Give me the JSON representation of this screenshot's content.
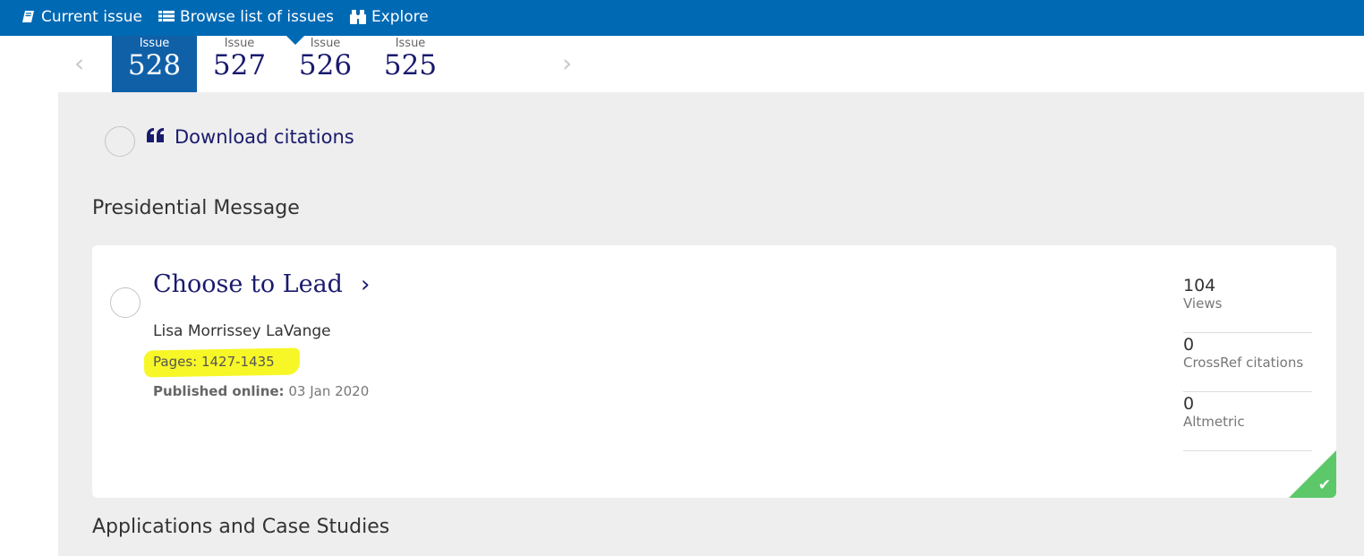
{
  "topnav": {
    "items": [
      {
        "icon": "book-icon",
        "label": "Current issue"
      },
      {
        "icon": "list-icon",
        "label": "Browse list of issues"
      },
      {
        "icon": "binoculars-icon",
        "label": "Explore"
      }
    ]
  },
  "issues": {
    "prev_icon": "‹",
    "next_icon": "›",
    "items": [
      {
        "label": "Issue",
        "number": "528",
        "active": true
      },
      {
        "label": "Issue",
        "number": "527"
      },
      {
        "label": "Issue",
        "number": "526"
      },
      {
        "label": "Issue",
        "number": "525"
      }
    ]
  },
  "download_citations": {
    "icon": "quote-icon",
    "label": "Download citations"
  },
  "sections": [
    {
      "heading": "Presidential Message",
      "articles": [
        {
          "title": "Choose to Lead",
          "title_chevron": "›",
          "author": "Lisa Morrissey LaVange",
          "pages": "Pages: 1427-1435",
          "published_label": "Published online:",
          "published_date": "03 Jan 2020",
          "metrics": [
            {
              "value": "104",
              "label": "Views"
            },
            {
              "value": "0",
              "label": "CrossRef citations"
            },
            {
              "value": "0",
              "label": "Altmetric"
            }
          ],
          "access_check": "✔",
          "access_color": "#5cc86a"
        }
      ]
    },
    {
      "heading": "Applications and Case Studies"
    }
  ],
  "colors": {
    "brand": "#0069b4",
    "active_issue": "#1060a8",
    "link": "#1a1a6e",
    "highlight": "#f7f728"
  }
}
